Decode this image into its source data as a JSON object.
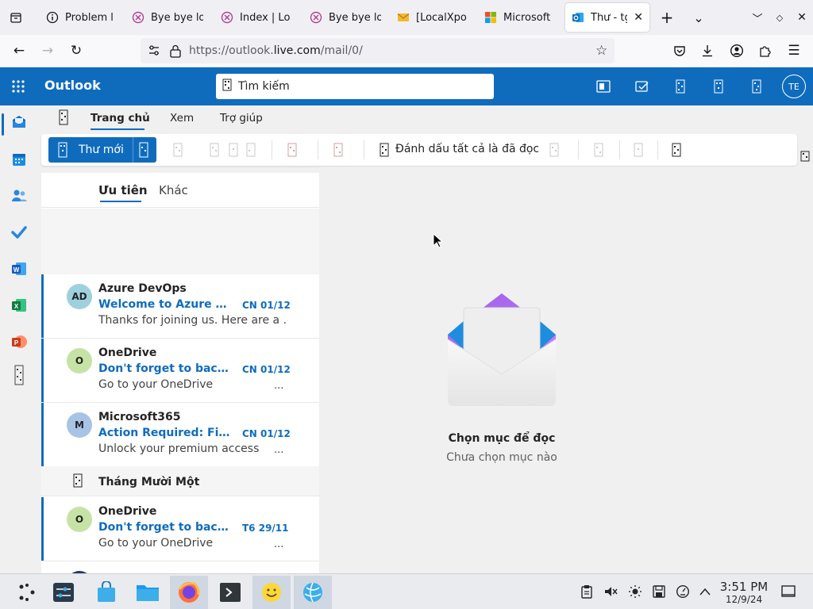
{
  "browser": {
    "tabs": [
      {
        "label": "Problem l",
        "icon": "info-icon"
      },
      {
        "label": "Bye bye lo",
        "icon": "bye-bye-favicon"
      },
      {
        "label": "Index | Lo",
        "icon": "bye-bye-favicon"
      },
      {
        "label": "Bye bye lo",
        "icon": "bye-bye-favicon"
      },
      {
        "label": "[LocalXpo",
        "icon": "mail-envelope-favicon"
      },
      {
        "label": "Microsoft",
        "icon": "microsoft-logo-favicon"
      },
      {
        "label": "Thư - tg",
        "icon": "outlook-favicon",
        "active": true
      }
    ],
    "url_prefix": "https://outlook.",
    "url_domain": "live.com",
    "url_suffix": "/mail/0/"
  },
  "outlook": {
    "app_title": "Outlook",
    "search_placeholder": "Tìm kiếm",
    "account_initials": "TE",
    "ribbon_tabs": [
      "Trang chủ",
      "Xem",
      "Trợ giúp"
    ],
    "new_mail_label": "Thư mới",
    "mark_all_read_label": "Đánh dấu tất cả là đã đọc"
  },
  "maillist": {
    "tabs": {
      "focused": "Ưu tiên",
      "other": "Khác"
    },
    "messages": [
      {
        "initials": "AD",
        "avatar_color": "#9fd0dd",
        "sender": "Azure DevOps",
        "subject": "Welcome to Azure De...",
        "date": "CN 01/12",
        "preview": "Thanks for joining us. Here are a ...",
        "ellipsis": ""
      },
      {
        "initials": "O",
        "avatar_color": "#c6e3a6",
        "sender": "OneDrive",
        "subject": "Don't forget to back u...",
        "date": "CN 01/12",
        "preview": "Go to your OneDrive",
        "ellipsis": "..."
      },
      {
        "initials": "M",
        "avatar_color": "#a9c3e6",
        "sender": "Microsoft365",
        "subject": "Action Required: Finis...",
        "date": "CN 01/12",
        "preview": "Unlock your premium access",
        "ellipsis": "..."
      },
      {
        "initials": "O",
        "avatar_color": "#c6e3a6",
        "sender": "OneDrive",
        "subject": "Don't forget to back u...",
        "date": "T6 29/11",
        "preview": "Go to your OneDrive",
        "ellipsis": "..."
      }
    ],
    "group_header": "Tháng Mười Một"
  },
  "reading_pane": {
    "title": "Chọn mục để đọc",
    "subtitle": "Chưa chọn mục nào"
  },
  "taskbar": {
    "time": "3:51 PM",
    "date": "12/9/24"
  },
  "colors": {
    "accent": "#0f6cbd"
  }
}
